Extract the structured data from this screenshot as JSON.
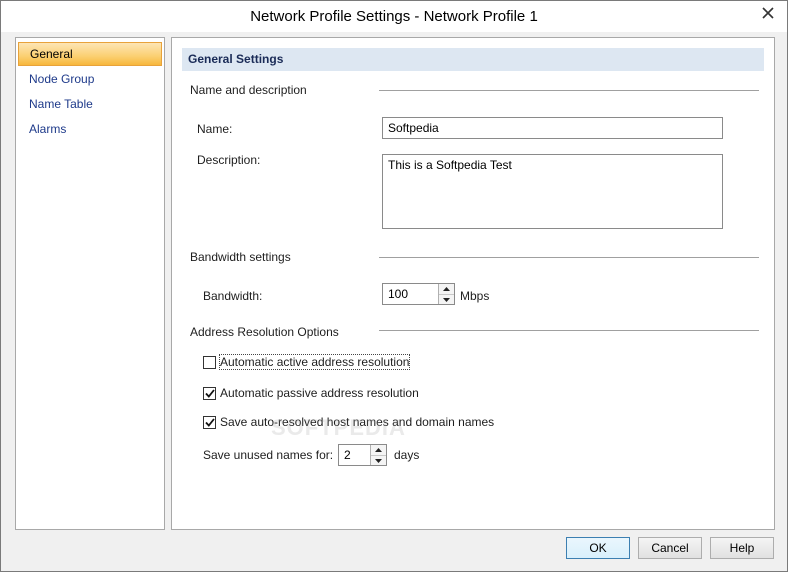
{
  "window": {
    "title": "Network Profile Settings - Network Profile 1"
  },
  "nav": {
    "items": [
      {
        "label": "General",
        "active": true
      },
      {
        "label": "Node Group",
        "active": false
      },
      {
        "label": "Name Table",
        "active": false
      },
      {
        "label": "Alarms",
        "active": false
      }
    ]
  },
  "general": {
    "section_title": "General Settings",
    "name_desc_group": "Name and description",
    "name_label": "Name:",
    "name_value": "Softpedia",
    "description_label": "Description:",
    "description_value": "This is a Softpedia Test",
    "bandwidth_group": "Bandwidth settings",
    "bandwidth_label": "Bandwidth:",
    "bandwidth_value": "100",
    "bandwidth_unit": "Mbps",
    "address_group": "Address Resolution Options",
    "checkboxes": [
      {
        "label": "Automatic active address resolution",
        "checked": false
      },
      {
        "label": "Automatic passive address resolution",
        "checked": true
      },
      {
        "label": "Save auto-resolved host names and domain names",
        "checked": true
      }
    ],
    "save_unused_label": "Save unused names for:",
    "save_unused_value": "2",
    "save_unused_unit": "days",
    "watermark": "SOFTPEDIA"
  },
  "buttons": {
    "ok": "OK",
    "cancel": "Cancel",
    "help": "Help"
  },
  "colors": {
    "accent_nav": "#f7b73c",
    "header_band": "#dde7f2",
    "link_text": "#1e3a8a"
  }
}
